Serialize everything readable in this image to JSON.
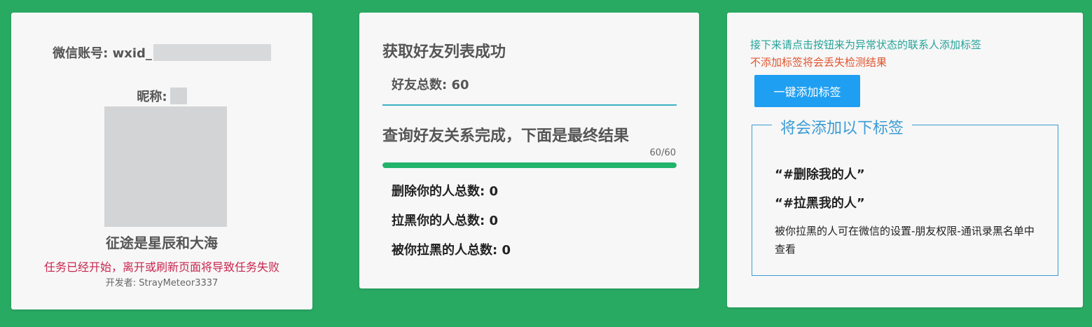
{
  "profile": {
    "account_label": "微信账号: wxid_",
    "nickname_label": "昵称:",
    "motto": "征途是星辰和大海",
    "warning": "任务已经开始，离开或刷新页面将导致任务失败",
    "developer": "开发者: StrayMeteor3337"
  },
  "progress": {
    "fetch_title": "获取好友列表成功",
    "total_friends": "好友总数: 60",
    "query_title": "查询好友关系完成，下面是最终结果",
    "progress_text": "60/60",
    "progress_fraction": 1.0,
    "deleted_stat": "删除你的人总数: 0",
    "blocked_stat": "拉黑你的人总数: 0",
    "blocked_by_you_stat": "被你拉黑的人总数: 0"
  },
  "tags": {
    "info_text": "接下来请点击按钮来为异常状态的联系人添加标签",
    "alert_text": "不添加标签将会丢失检测结果",
    "button_label": "一键添加标签",
    "legend": "将会添加以下标签",
    "tag_deleted": "“#删除我的人”",
    "tag_blocked": "“#拉黑我的人”",
    "note": "被你拉黑的人可在微信的设置-朋友权限-通讯录黑名单中查看"
  },
  "colors": {
    "background": "#29aa63",
    "progress_fill": "#22b46b",
    "accent_blue": "#1e9ff2",
    "warning_red": "#c9254e",
    "info_teal": "#27a39a",
    "alert_orange": "#e0552e"
  }
}
